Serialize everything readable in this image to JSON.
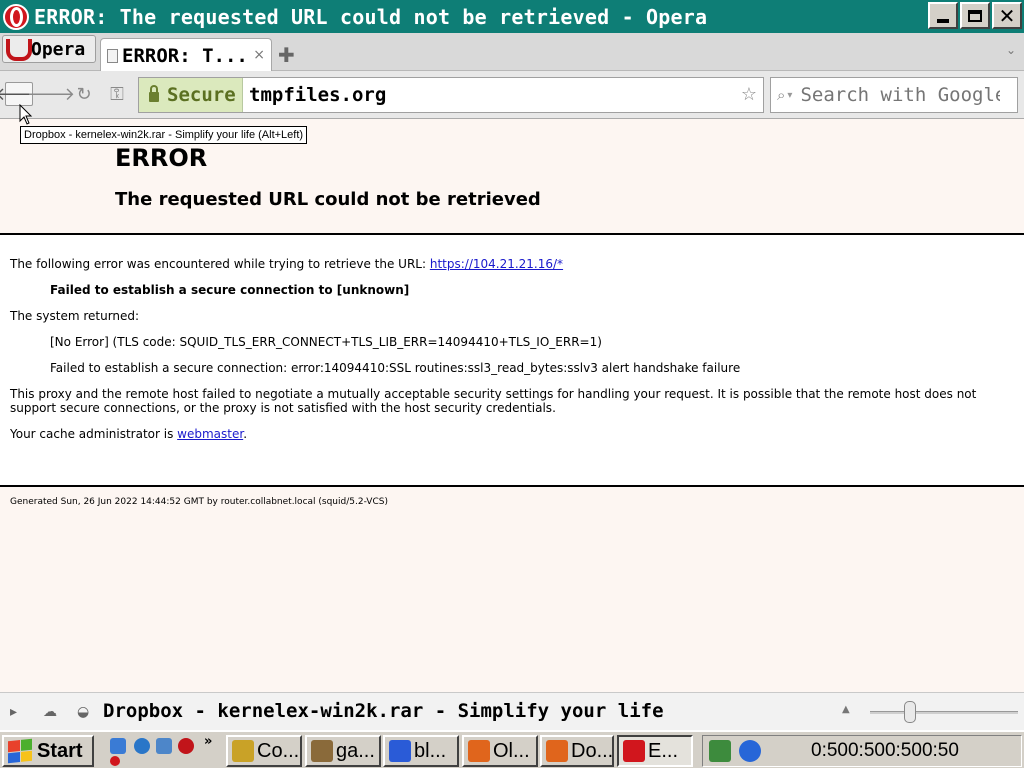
{
  "window": {
    "title": "ERROR: The requested URL could not be retrieved - Opera",
    "minimize_icon": "minimize-icon",
    "maximize_icon": "restore-icon",
    "close_label": "✕"
  },
  "tabbar": {
    "menu_label": "Opera",
    "active_tab_label": "ERROR: T...",
    "close_label": "×",
    "new_tab_label": "✚",
    "tab_menu_icon": "⌄"
  },
  "navbar": {
    "back_icon": "🡐",
    "forward_icon": "🡒",
    "reload_icon": "↻",
    "key_icon": "⚿",
    "secure_label": "Secure",
    "url": "tmpfiles.org",
    "star_icon": "☆",
    "search_icon": "⌕",
    "search_placeholder": "Search with Google"
  },
  "tooltip": "Dropbox - kernelex-win2k.rar - Simplify your life (Alt+Left)",
  "page": {
    "title": "ERROR",
    "subtitle": "The requested URL could not be retrieved",
    "intro": "The following error was encountered while trying to retrieve the URL: ",
    "url_link": "https://104.21.21.16/*",
    "failed_bold": "Failed to establish a secure connection to [unknown]",
    "system_returned": "The system returned:",
    "no_error_line": "[No Error] (TLS code: SQUID_TLS_ERR_CONNECT+TLS_LIB_ERR=14094410+TLS_IO_ERR=1)",
    "ssl_line": "Failed to establish a secure connection: error:14094410:SSL routines:ssl3_read_bytes:sslv3 alert handshake failure",
    "proxy_text": "This proxy and the remote host failed to negotiate a mutually acceptable security settings for handling your request. It is possible that the remote host does not support secure connections, or the proxy is not satisfied with the host security credentials.",
    "admin_prefix": "Your cache administrator is ",
    "admin_link": "webmaster",
    "admin_suffix": ".",
    "generated": "Generated Sun, 26 Jun 2022 14:44:52 GMT by router.collabnet.local (squid/5.2-VCS)"
  },
  "statusbar": {
    "text": "Dropbox - kernelex-win2k.rar - Simplify your life",
    "zoom_up_icon": "▲",
    "zoom_level": 0.25
  },
  "taskbar": {
    "start_label": "Start",
    "quicklaunch_more": "»",
    "tasks": [
      {
        "label": "Co...",
        "color": "#c9a227"
      },
      {
        "label": "ga...",
        "color": "#8a6a3a"
      },
      {
        "label": "bl...",
        "color": "#2a5bd7"
      },
      {
        "label": "Ol...",
        "color": "#e0651c"
      },
      {
        "label": "Do...",
        "color": "#e0651c"
      },
      {
        "label": "E...",
        "color": "#d1161d"
      }
    ],
    "clock": "0:500:500:500:50"
  },
  "colors": {
    "titlebar": "#0e7e76",
    "secure_green": "#5b7021",
    "link": "#1a1acc",
    "opera_red": "#d1161d"
  }
}
